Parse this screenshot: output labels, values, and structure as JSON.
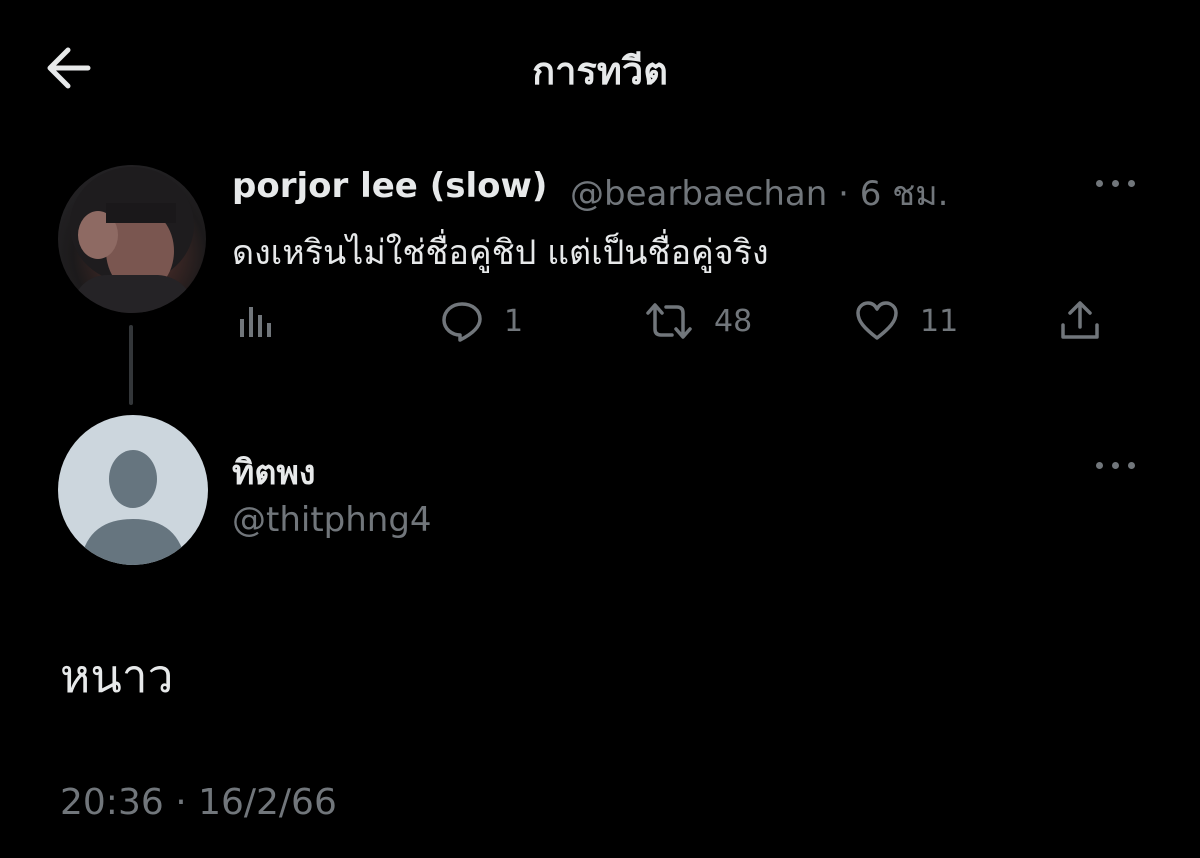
{
  "header": {
    "title": "การทวีต",
    "back_icon": "arrow-left-icon"
  },
  "parent_tweet": {
    "display_name": "porjor lee (slow)",
    "meta": "@bearbaechan · 6 ชม.",
    "text": "ดงเหรินไม่ใช่ชื่อคู่ชิป แต่เป็นชื่อคู่จริง",
    "actions": {
      "analytics_icon": "bar-chart-icon",
      "reply_count": "1",
      "retweet_count": "48",
      "like_count": "11",
      "share_icon": "share-icon"
    }
  },
  "reply_tweet": {
    "display_name": "ทิตพง",
    "handle": "@thitphng4",
    "text": "หนาว",
    "timestamp": "20:36 · 16/2/66"
  },
  "colors": {
    "background": "#000000",
    "primary_text": "#e7e9ea",
    "secondary_text": "#71767b",
    "thread_line": "#333639",
    "default_avatar_bg": "#ccd6dd",
    "default_avatar_fg": "#66757f"
  }
}
